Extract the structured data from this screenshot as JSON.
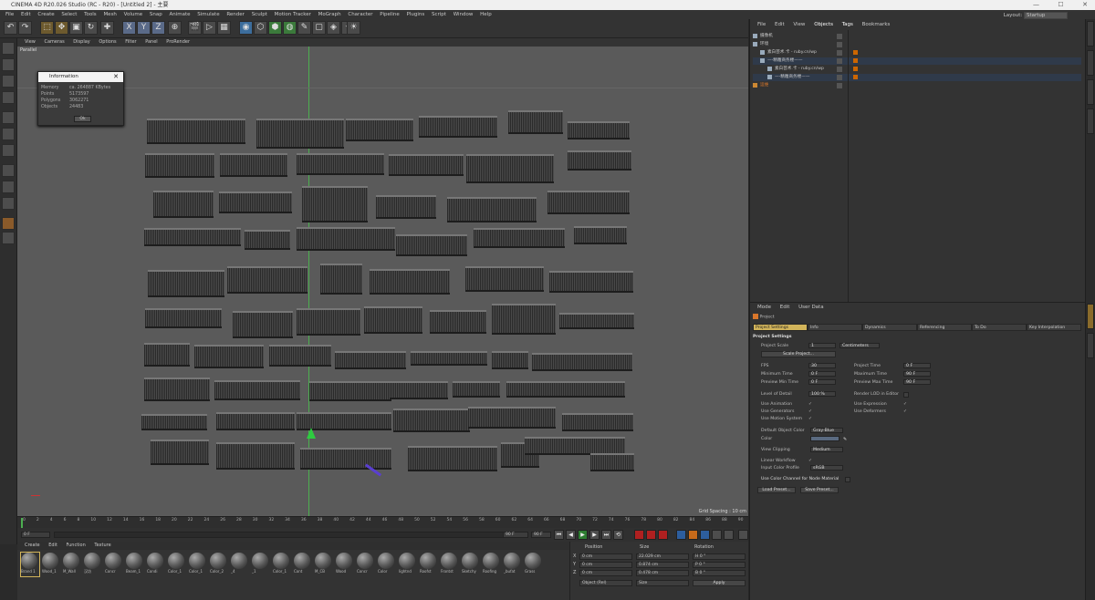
{
  "titlebar": {
    "title": "CINEMA 4D R20.026 Studio (RC - R20) - [Untitled 2] - 主要",
    "controls": [
      "—",
      "☐",
      "✕"
    ]
  },
  "menubar": {
    "items": [
      "File",
      "Edit",
      "Create",
      "Select",
      "Tools",
      "Mesh",
      "Volume",
      "Snap",
      "Animate",
      "Simulate",
      "Render",
      "Sculpt",
      "Motion Tracker",
      "MoGraph",
      "Character",
      "Pipeline",
      "Plugins",
      "Script",
      "Window",
      "Help"
    ],
    "layout_label": "Layout:",
    "layout_value": "Startup"
  },
  "toolbar": {
    "buttons": [
      "↶",
      "↷",
      "⬚",
      "✥",
      "▣",
      "↻",
      "✚",
      "X",
      "Y",
      "Z",
      "⊕",
      "🎬",
      "▷",
      "▦",
      "◉",
      "⬡",
      "⬢",
      "◍",
      "✎",
      "▢",
      "◈",
      "✦",
      "☀"
    ]
  },
  "viewport": {
    "menu": [
      "View",
      "Cameras",
      "Display",
      "Options",
      "Filter",
      "Panel",
      "ProRender"
    ],
    "label": "Parallel",
    "grid_spacing": "Grid Spacing : 10 cm"
  },
  "info_dialog": {
    "title": "Information",
    "rows": [
      {
        "k": "Memory",
        "v": "ca. 264887 KBytes"
      },
      {
        "k": "Points",
        "v": "5173597"
      },
      {
        "k": "Polygons",
        "v": "3062271"
      },
      {
        "k": "Objects",
        "v": "24483"
      }
    ],
    "ok": "Ok"
  },
  "timeline": {
    "ticks": [
      "0",
      "2",
      "4",
      "6",
      "8",
      "10",
      "12",
      "14",
      "16",
      "18",
      "20",
      "22",
      "24",
      "26",
      "28",
      "30",
      "32",
      "34",
      "36",
      "38",
      "40",
      "42",
      "44",
      "46",
      "48",
      "50",
      "52",
      "54",
      "56",
      "58",
      "60",
      "62",
      "64",
      "66",
      "68",
      "70",
      "72",
      "74",
      "76",
      "78",
      "80",
      "82",
      "84",
      "86",
      "88",
      "90"
    ],
    "current": "0 F",
    "start": "0 F",
    "end": "90 F",
    "end2": "90 F"
  },
  "transport": {
    "buttons": [
      "⏮",
      "◀",
      "▶",
      "▶",
      "⏭",
      "⟲"
    ]
  },
  "materials": {
    "menu": [
      "Create",
      "Edit",
      "Function",
      "Texture"
    ],
    "items": [
      "Brand 1",
      "Wood_1",
      "M_Wall",
      "汉坊",
      "Concr",
      "Beam_1",
      "Condi",
      "Color_1",
      "Color_1",
      "Color_2",
      "_4",
      "_1",
      "Color_1",
      "Cont",
      "M_CB",
      "Wood",
      "Concr",
      "Color",
      "lightnd",
      "Roofst",
      "Frontst",
      "Sketchy",
      "Roofing",
      "_bufat",
      "Grass",
      "Timber"
    ]
  },
  "coords": {
    "headers": [
      "Position",
      "Size",
      "Rotation"
    ],
    "rows": [
      {
        "axis": "X",
        "pos": "0 cm",
        "size": "22.029 cm",
        "rot": "H 0 °"
      },
      {
        "axis": "Y",
        "pos": "0 cm",
        "size": "0.874 cm",
        "rot": "P 0 °"
      },
      {
        "axis": "Z",
        "pos": "0 cm",
        "size": "0.478 cm",
        "rot": "B 0 °"
      }
    ],
    "mode": "Object (Rel)",
    "size_mode": "Size",
    "apply": "Apply"
  },
  "object_manager": {
    "menu": [
      "File",
      "Edit",
      "View",
      "Objects",
      "Tags",
      "Bookmarks"
    ],
    "rows": [
      {
        "name": "摄像机",
        "indent": 0
      },
      {
        "name": "环境",
        "indent": 0
      },
      {
        "name": "素白芸术.卡 - ruby.cn/wp",
        "indent": 8
      },
      {
        "name": "—-精雕商务楼——",
        "indent": 8
      },
      {
        "name": "素白芸术.卡 - ruby.cn/wp",
        "indent": 16
      },
      {
        "name": "—-精雕商务楼——",
        "indent": 16
      },
      {
        "name": "运维",
        "indent": 0
      }
    ]
  },
  "attribute_manager": {
    "menu": [
      "Mode",
      "Edit",
      "User Data"
    ],
    "object_label": "Project",
    "tabs": [
      "Project Settings",
      "Info",
      "Dynamics",
      "Referencing",
      "To Do",
      "Key Interpolation"
    ],
    "section": "Project Settings",
    "scale_label": "Project Scale",
    "scale_value": "1",
    "scale_unit": "Centimeters",
    "scale_button": "Scale Project...",
    "fps_label": "FPS",
    "fps": "30",
    "project_time_label": "Project Time",
    "project_time": "0 F",
    "min_time_label": "Minimum Time",
    "min_time": "0 F",
    "max_time_label": "Maximum Time",
    "max_time": "90 F",
    "prev_min_label": "Preview Min Time",
    "prev_min": "0 F",
    "prev_max_label": "Preview Max Time",
    "prev_max": "90 F",
    "lod_label": "Level of Detail",
    "lod": "100 %",
    "render_lod_label": "Render LOD in Editor",
    "use_anim": "Use Animation",
    "use_expr": "Use Expression",
    "use_gen": "Use Generators",
    "use_deform": "Use Deformers",
    "use_motion": "Use Motion System",
    "default_color_label": "Default Object Color",
    "default_color": "Gray-Blue",
    "color_label": "Color",
    "view_clip_label": "View Clipping",
    "view_clip": "Medium",
    "linear_label": "Linear Workflow",
    "input_profile_label": "Input Color Profile",
    "input_profile": "sRGB",
    "node_mat_label": "Use Color Channel for Node Material",
    "load_preset": "Load Preset...",
    "save_preset": "Save Preset...",
    "check": "✓"
  }
}
